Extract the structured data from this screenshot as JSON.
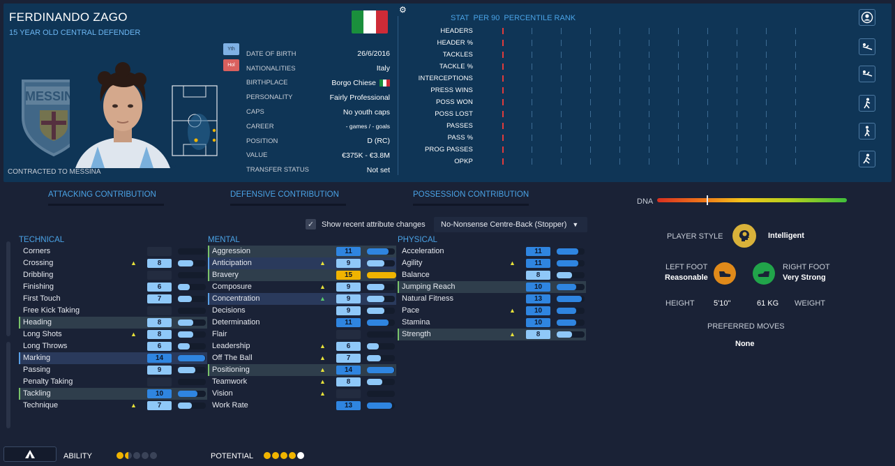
{
  "player": {
    "name": "FERDINANDO ZAGO",
    "subtitle": "15 YEAR OLD CENTRAL DEFENDER",
    "contracted": "CONTRACTED TO MESSINA",
    "club_crest_text": "MESSINA",
    "badges": {
      "youth": "Yth",
      "hol": "Hol"
    }
  },
  "info": [
    {
      "label": "DATE OF BIRTH",
      "value": "26/6/2016"
    },
    {
      "label": "NATIONALITIES",
      "value": "Italy"
    },
    {
      "label": "BIRTHPLACE",
      "value": "Borgo Chiese"
    },
    {
      "label": "PERSONALITY",
      "value": "Fairly Professional"
    },
    {
      "label": "CAPS",
      "value": "No youth caps"
    },
    {
      "label": "CAREER",
      "value": "- games /      - goals"
    },
    {
      "label": "POSITION",
      "value": "D (RC)"
    },
    {
      "label": "VALUE",
      "value": "€375K - €3.8M"
    },
    {
      "label": "TRANSFER STATUS",
      "value": "Not set"
    }
  ],
  "colors": {
    "flag_green": "#1a8f3c",
    "flag_white": "#ffffff",
    "flag_red": "#ce2b37",
    "accent": "#4aa3e6"
  },
  "stats": {
    "header": [
      "STAT",
      "PER 90",
      "PERCENTILE RANK"
    ],
    "rows": [
      {
        "label": "HEADERS",
        "percentile": 0
      },
      {
        "label": "HEADER %",
        "percentile": 0
      },
      {
        "label": "TACKLES",
        "percentile": 0
      },
      {
        "label": "TACKLE %",
        "percentile": 0
      },
      {
        "label": "INTERCEPTIONS",
        "percentile": 0
      },
      {
        "label": "PRESS WINS",
        "percentile": 0
      },
      {
        "label": "POSS WON",
        "percentile": 0
      },
      {
        "label": "POSS LOST",
        "percentile": 0
      },
      {
        "label": "PASSES",
        "percentile": 0
      },
      {
        "label": "PASS %",
        "percentile": 0
      },
      {
        "label": "PROG PASSES",
        "percentile": 0
      },
      {
        "label": "OPKP",
        "percentile": 0
      }
    ]
  },
  "contributions": {
    "attacking": "ATTACKING CONTRIBUTION",
    "defensive": "DEFENSIVE CONTRIBUTION",
    "possession": "POSSESSION CONTRIBUTION"
  },
  "dna": {
    "label": "DNA",
    "level": 0.26
  },
  "filter": {
    "show_changes_label": "Show recent attribute changes",
    "checked": true,
    "role": "No-Nonsense Centre-Back (Stopper)"
  },
  "technical": {
    "title": "TECHNICAL",
    "attributes": [
      {
        "name": "Corners",
        "value": "",
        "level": 0,
        "arrow": "",
        "hl": ""
      },
      {
        "name": "Crossing",
        "value": "8",
        "level": 8,
        "arrow": "up",
        "hl": ""
      },
      {
        "name": "Dribbling",
        "value": "",
        "level": 0,
        "arrow": "",
        "hl": ""
      },
      {
        "name": "Finishing",
        "value": "6",
        "level": 6,
        "arrow": "",
        "hl": ""
      },
      {
        "name": "First Touch",
        "value": "7",
        "level": 7,
        "arrow": "",
        "hl": ""
      },
      {
        "name": "Free Kick Taking",
        "value": "",
        "level": 0,
        "arrow": "",
        "hl": ""
      },
      {
        "name": "Heading",
        "value": "8",
        "level": 8,
        "arrow": "",
        "hl": "green"
      },
      {
        "name": "Long Shots",
        "value": "8",
        "level": 8,
        "arrow": "up",
        "hl": ""
      },
      {
        "name": "Long Throws",
        "value": "6",
        "level": 6,
        "arrow": "",
        "hl": ""
      },
      {
        "name": "Marking",
        "value": "14",
        "level": 14,
        "arrow": "",
        "hl": "blue"
      },
      {
        "name": "Passing",
        "value": "9",
        "level": 9,
        "arrow": "",
        "hl": ""
      },
      {
        "name": "Penalty Taking",
        "value": "",
        "level": 0,
        "arrow": "",
        "hl": ""
      },
      {
        "name": "Tackling",
        "value": "10",
        "level": 10,
        "arrow": "",
        "hl": "green"
      },
      {
        "name": "Technique",
        "value": "7",
        "level": 7,
        "arrow": "up",
        "hl": ""
      }
    ]
  },
  "mental": {
    "title": "MENTAL",
    "attributes": [
      {
        "name": "Aggression",
        "value": "11",
        "level": 11,
        "arrow": "",
        "hl": "green"
      },
      {
        "name": "Anticipation",
        "value": "9",
        "level": 9,
        "arrow": "up",
        "hl": "blue"
      },
      {
        "name": "Bravery",
        "value": "15",
        "level": 15,
        "arrow": "",
        "hl": "green"
      },
      {
        "name": "Composure",
        "value": "9",
        "level": 9,
        "arrow": "up",
        "hl": ""
      },
      {
        "name": "Concentration",
        "value": "9",
        "level": 9,
        "arrow": "up-green",
        "hl": "blue"
      },
      {
        "name": "Decisions",
        "value": "9",
        "level": 9,
        "arrow": "",
        "hl": ""
      },
      {
        "name": "Determination",
        "value": "11",
        "level": 11,
        "arrow": "",
        "hl": ""
      },
      {
        "name": "Flair",
        "value": "",
        "level": 0,
        "arrow": "",
        "hl": ""
      },
      {
        "name": "Leadership",
        "value": "6",
        "level": 6,
        "arrow": "up",
        "hl": ""
      },
      {
        "name": "Off The Ball",
        "value": "7",
        "level": 7,
        "arrow": "up",
        "hl": ""
      },
      {
        "name": "Positioning",
        "value": "14",
        "level": 14,
        "arrow": "up",
        "hl": "green"
      },
      {
        "name": "Teamwork",
        "value": "8",
        "level": 8,
        "arrow": "up",
        "hl": ""
      },
      {
        "name": "Vision",
        "value": "",
        "level": 0,
        "arrow": "up",
        "hl": ""
      },
      {
        "name": "Work Rate",
        "value": "13",
        "level": 13,
        "arrow": "",
        "hl": ""
      }
    ]
  },
  "physical": {
    "title": "PHYSICAL",
    "attributes": [
      {
        "name": "Acceleration",
        "value": "11",
        "level": 11,
        "arrow": "",
        "hl": ""
      },
      {
        "name": "Agility",
        "value": "11",
        "level": 11,
        "arrow": "up",
        "hl": ""
      },
      {
        "name": "Balance",
        "value": "8",
        "level": 8,
        "arrow": "",
        "hl": ""
      },
      {
        "name": "Jumping Reach",
        "value": "10",
        "level": 10,
        "arrow": "",
        "hl": "green"
      },
      {
        "name": "Natural Fitness",
        "value": "13",
        "level": 13,
        "arrow": "",
        "hl": ""
      },
      {
        "name": "Pace",
        "value": "10",
        "level": 10,
        "arrow": "up",
        "hl": ""
      },
      {
        "name": "Stamina",
        "value": "10",
        "level": 10,
        "arrow": "",
        "hl": ""
      },
      {
        "name": "Strength",
        "value": "8",
        "level": 8,
        "arrow": "up",
        "hl": "green"
      }
    ]
  },
  "profile": {
    "player_style_label": "PLAYER STYLE",
    "player_style_value": "Intelligent",
    "left_foot_label": "LEFT FOOT",
    "left_foot_value": "Reasonable",
    "right_foot_label": "RIGHT FOOT",
    "right_foot_value": "Very Strong",
    "height_label": "HEIGHT",
    "height_value": "5'10\"",
    "weight_value": "61 KG",
    "weight_label": "WEIGHT",
    "preferred_moves_label": "PREFERRED MOVES",
    "preferred_moves_value": "None"
  },
  "bottom": {
    "ability_label": "ABILITY",
    "ability_stars": 1.5,
    "potential_label": "POTENTIAL",
    "potential_stars": 4.5,
    "star_color": "#f0b400"
  }
}
